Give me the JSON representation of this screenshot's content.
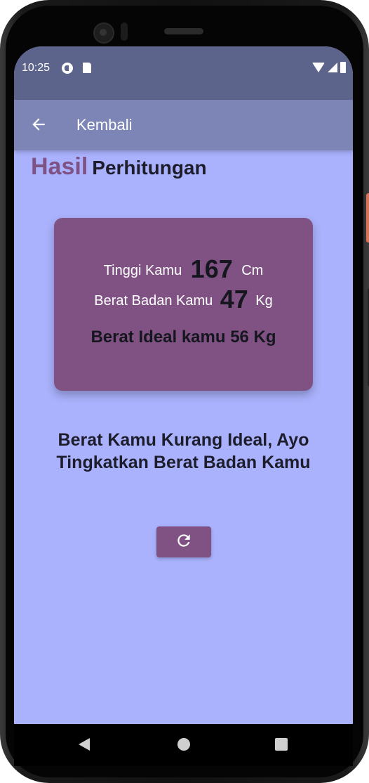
{
  "status_bar": {
    "time": "10:25"
  },
  "app_bar": {
    "back_icon": "arrow-left-icon",
    "title": "Kembali"
  },
  "heading": {
    "accent": "Hasil",
    "rest": "Perhitungan"
  },
  "result_card": {
    "height_label": "Tinggi Kamu",
    "height_value": "167",
    "height_unit": "Cm",
    "weight_label": "Berat Badan Kamu",
    "weight_value": "47",
    "weight_unit": "Kg",
    "ideal_text": "Berat Ideal kamu 56 Kg"
  },
  "message": {
    "line1": "Berat Kamu Kurang Ideal, Ayo",
    "line2": "Tingkatkan Berat Badan Kamu"
  },
  "refresh_button": {
    "icon": "refresh-icon"
  },
  "nav_bar": {
    "back_icon": "nav-back-icon",
    "home_icon": "nav-home-icon",
    "recent_icon": "nav-recent-icon"
  },
  "colors": {
    "screen_bg": "#aab2fd",
    "status_bar": "#5d648c",
    "app_bar": "#7d85b6",
    "accent_purple": "#7f5283",
    "text_dark": "#1d1d2c"
  }
}
